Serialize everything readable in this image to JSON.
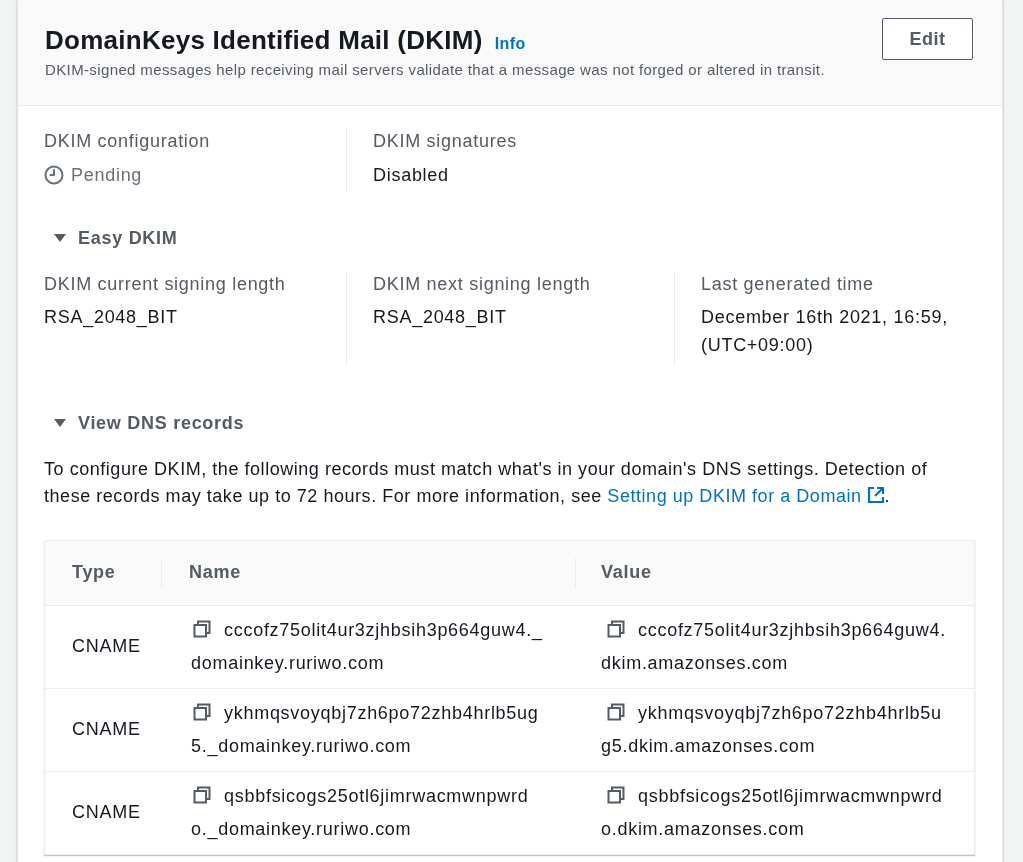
{
  "panel": {
    "title": "DomainKeys Identified Mail (DKIM)",
    "info_link": "Info",
    "description": "DKIM-signed messages help receiving mail servers validate that a message was not forged or altered in transit.",
    "edit_button": "Edit"
  },
  "summary": [
    {
      "label": "DKIM configuration",
      "value": "Pending",
      "kind": "status"
    },
    {
      "label": "DKIM signatures",
      "value": "Disabled",
      "kind": "text"
    }
  ],
  "easy_dkim": {
    "label": "Easy DKIM",
    "expanded": true,
    "fields": [
      {
        "label": "DKIM current signing length",
        "value": "RSA_2048_BIT"
      },
      {
        "label": "DKIM next signing length",
        "value": "RSA_2048_BIT"
      },
      {
        "label": "Last generated time",
        "value": "December 16th 2021, 16:59, (UTC+09:00)"
      }
    ]
  },
  "dns_records": {
    "label": "View DNS records",
    "expanded": true,
    "description": "To configure DKIM, the following records must match what's in your domain's DNS settings. Detection of these records may take up to 72 hours. For more information, see ",
    "link": "Setting up DKIM for a Domain",
    "description_end": ".",
    "table": {
      "columns": [
        "Type",
        "Name",
        "Value"
      ],
      "rows": [
        {
          "type": "CNAME",
          "name": "cccofz75olit4ur3zjhbsih3p664guw4._domainkey.ruriwo.com",
          "value": "cccofz75olit4ur3zjhbsih3p664guw4.dkim.amazonses.com"
        },
        {
          "type": "CNAME",
          "name": "ykhmqsvoyqbj7zh6po72zhb4hrlb5ug5._domainkey.ruriwo.com",
          "value": "ykhmqsvoyqbj7zh6po72zhb4hrlb5ug5.dkim.amazonses.com"
        },
        {
          "type": "CNAME",
          "name": "qsbbfsicogs25otl6jimrwacmwnpwrdo._domainkey.ruriwo.com",
          "value": "qsbbfsicogs25otl6jimrwacmwnpwrdo.dkim.amazonses.com"
        }
      ]
    }
  }
}
